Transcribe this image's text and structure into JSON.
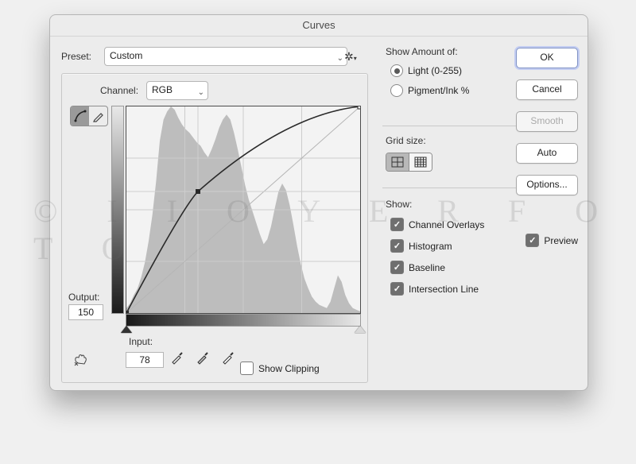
{
  "title": "Curves",
  "preset": {
    "label": "Preset:",
    "value": "Custom"
  },
  "channel": {
    "label": "Channel:",
    "value": "RGB"
  },
  "output": {
    "label": "Output:",
    "value": "150"
  },
  "input": {
    "label": "Input:",
    "value": "78"
  },
  "show_clipping": {
    "label": "Show Clipping",
    "checked": false
  },
  "show_amount": {
    "label": "Show Amount of:",
    "light": {
      "label": "Light  (0-255)",
      "selected": true
    },
    "pigment": {
      "label": "Pigment/Ink %",
      "selected": false
    }
  },
  "grid_size": {
    "label": "Grid size:"
  },
  "show": {
    "label": "Show:",
    "channel_overlays": {
      "label": "Channel Overlays",
      "checked": true
    },
    "histogram": {
      "label": "Histogram",
      "checked": true
    },
    "baseline": {
      "label": "Baseline",
      "checked": true
    },
    "intersection_line": {
      "label": "Intersection Line",
      "checked": true
    }
  },
  "preview": {
    "label": "Preview",
    "checked": true
  },
  "buttons": {
    "ok": "OK",
    "cancel": "Cancel",
    "smooth": "Smooth",
    "auto": "Auto",
    "options": "Options..."
  },
  "watermark": "© I I O Y E R F O T O",
  "chart_data": {
    "type": "line",
    "title": "Curves",
    "xlabel": "Input",
    "ylabel": "Output",
    "xlim": [
      0,
      255
    ],
    "ylim": [
      0,
      255
    ],
    "series": [
      {
        "name": "baseline",
        "x": [
          0,
          255
        ],
        "y": [
          0,
          255
        ]
      },
      {
        "name": "curve",
        "x": [
          0,
          78,
          255
        ],
        "y": [
          0,
          150,
          255
        ]
      }
    ],
    "histogram_bins": [
      6,
      12,
      22,
      30,
      44,
      62,
      88,
      120,
      160,
      210,
      236,
      246,
      252,
      248,
      238,
      230,
      224,
      220,
      214,
      208,
      204,
      196,
      190,
      200,
      212,
      226,
      236,
      242,
      236,
      220,
      200,
      178,
      156,
      138,
      124,
      110,
      96,
      84,
      90,
      106,
      128,
      148,
      158,
      150,
      132,
      108,
      82,
      60,
      42,
      30,
      20,
      14,
      10,
      8,
      6,
      14,
      30,
      46,
      38,
      22,
      12,
      6,
      4,
      2
    ],
    "control_point": {
      "input": 78,
      "output": 150
    }
  }
}
